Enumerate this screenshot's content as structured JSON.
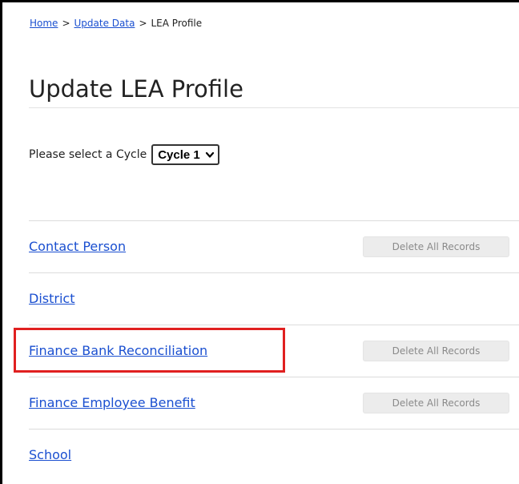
{
  "breadcrumb": {
    "home": "Home",
    "update_data": "Update Data",
    "current": "LEA Profile",
    "separator": ">"
  },
  "page_title": "Update LEA Profile",
  "cycle": {
    "label": "Please select a Cycle",
    "selected": "Cycle 1"
  },
  "items": [
    {
      "label": "Contact Person",
      "delete_label": "Delete All Records"
    },
    {
      "label": "District"
    },
    {
      "label": "Finance Bank Reconciliation",
      "delete_label": "Delete All Records"
    },
    {
      "label": "Finance Employee Benefit",
      "delete_label": "Delete All Records"
    },
    {
      "label": "School"
    }
  ],
  "colors": {
    "link": "#1a4fd0",
    "highlight": "#e02020",
    "disabled_button_bg": "#ececec"
  }
}
